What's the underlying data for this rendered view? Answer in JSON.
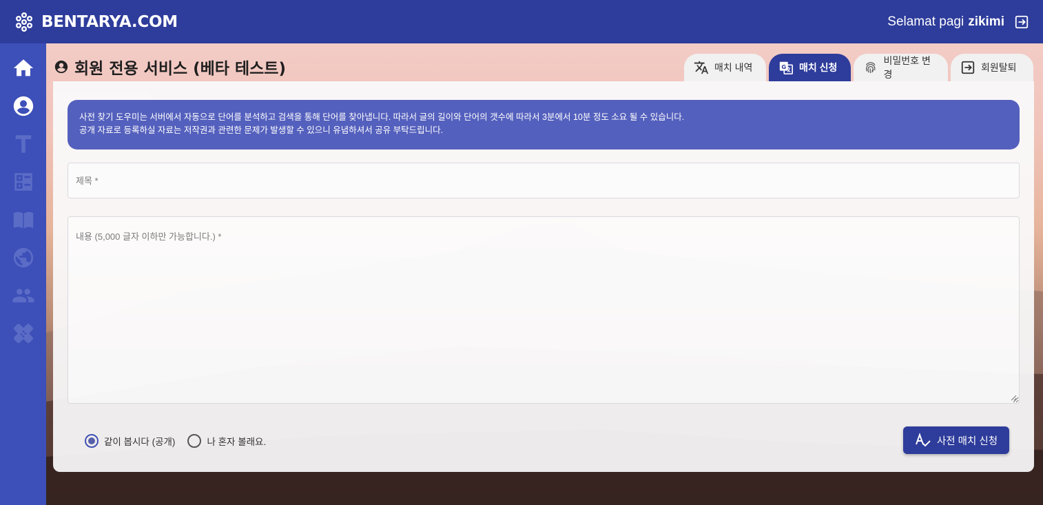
{
  "header": {
    "brand": "BENTARYA.COM",
    "greeting_prefix": "Selamat pagi",
    "username": "zikimi",
    "logout_icon": "logout-icon"
  },
  "sidebar": {
    "items": [
      {
        "name": "home",
        "icon": "home-icon"
      },
      {
        "name": "account",
        "icon": "account-circle-icon"
      },
      {
        "name": "text",
        "icon": "text-icon"
      },
      {
        "name": "dashboard",
        "icon": "list-grid-icon"
      },
      {
        "name": "book",
        "icon": "book-icon"
      },
      {
        "name": "globe",
        "icon": "globe-icon"
      },
      {
        "name": "people",
        "icon": "people-icon"
      },
      {
        "name": "bandage",
        "icon": "bandage-icon"
      }
    ]
  },
  "page": {
    "title": "회원 전용 서비스 (베타 테스트)"
  },
  "tabs": [
    {
      "label": "매치 내역",
      "icon": "translate-icon",
      "active": false
    },
    {
      "label": "매치 신청",
      "icon": "g-translate-icon",
      "active": true
    },
    {
      "label": "비밀번호 변경",
      "icon": "fingerprint-icon",
      "active": false
    },
    {
      "label": "회원탈퇴",
      "icon": "exit-icon",
      "active": false
    }
  ],
  "notice": {
    "line1": "사전 찾기 도우미는 서버에서 자동으로 단어를 분석하고 검색을 통해 단어를 찾아냅니다. 따라서 글의 길이와 단어의 갯수에 따라서 3분에서 10분 정도 소요 될 수 있습니다.",
    "line2": "공개 자료로 등록하실 자료는 저작권과 관련한 문제가 발생할 수 있으니 유념하셔서 공유 부탁드립니다."
  },
  "form": {
    "title_placeholder": "제목 *",
    "title_value": "",
    "body_placeholder": "내용 (5,000 글자 이하만 가능합니다.) *",
    "body_value": "",
    "radio_public": "같이 봅시다 (공개)",
    "radio_private": "나 혼자 볼래요.",
    "selected": "public",
    "submit_label": "사전 매치 신청"
  },
  "colors": {
    "primary": "#2e3c9b",
    "sidebar": "#3d4fb8",
    "notice": "#5460bd"
  }
}
